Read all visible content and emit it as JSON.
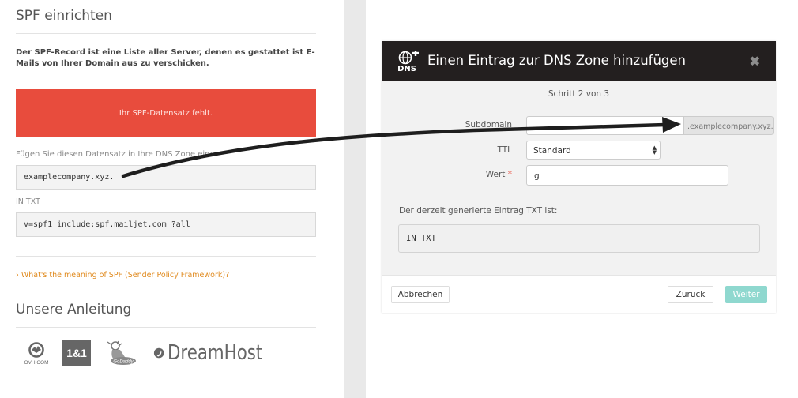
{
  "left": {
    "title": "SPF einrichten",
    "description": "Der SPF-Record ist eine Liste aller Server, denen es gestattet ist E-Mails von Ihrer Domain aus zu verschicken.",
    "alert": "Ihr SPF-Datensatz fehlt.",
    "hint": "Fügen Sie diesen Datensatz in Ihre DNS Zone ein:",
    "host_value": "examplecompany.xyz.",
    "record_type": "IN TXT",
    "record_value": "v=spf1 include:spf.mailjet.com ?all",
    "spf_link": "What's the meaning of SPF (Sender Policy Framework)?",
    "guide_title": "Unsere Anleitung",
    "logos": [
      "OVH.COM",
      "1&1",
      "GoDaddy",
      "DreamHost"
    ]
  },
  "modal": {
    "title": "Einen Eintrag zur DNS Zone hinzufügen",
    "icon_text": "DNS",
    "step": "Schritt 2 von 3",
    "subdomain_label": "Subdomain",
    "subdomain_value": "",
    "subdomain_suffix": ".examplecompany.xyz.",
    "ttl_label": "TTL",
    "ttl_value": "Standard",
    "value_label": "Wert",
    "value_required": "*",
    "value_value": "g",
    "generated_label": "Der derzeit generierte Eintrag TXT ist:",
    "generated_value": "IN TXT",
    "cancel_label": "Abbrechen",
    "back_label": "Zurück",
    "next_label": "Weiter"
  },
  "colors": {
    "alert": "#e84c3d",
    "link": "#e08a1e",
    "header": "#231f1f",
    "next_button": "#8fd8cf"
  }
}
